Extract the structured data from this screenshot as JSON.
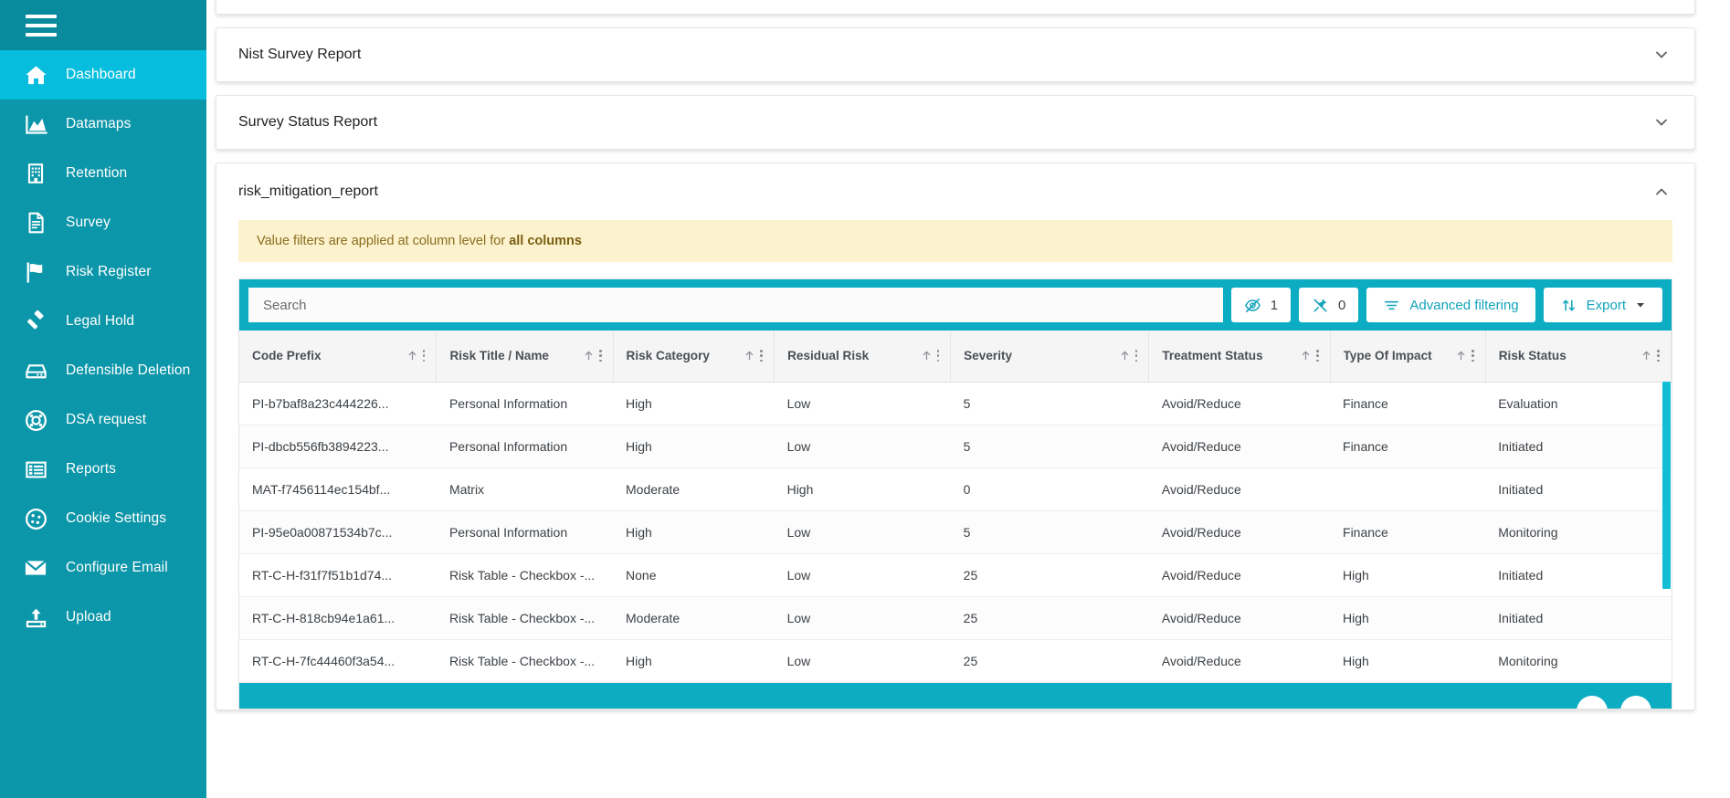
{
  "sidebar": {
    "menu_icon": "hamburger-icon",
    "items": [
      {
        "label": "Dashboard",
        "icon": "home-icon",
        "active": true
      },
      {
        "label": "Datamaps",
        "icon": "chart-area-icon",
        "active": false
      },
      {
        "label": "Retention",
        "icon": "building-icon",
        "active": false
      },
      {
        "label": "Survey",
        "icon": "document-icon",
        "active": false
      },
      {
        "label": "Risk Register",
        "icon": "flag-icon",
        "active": false
      },
      {
        "label": "Legal Hold",
        "icon": "gavel-icon",
        "active": false
      },
      {
        "label": "Defensible Deletion",
        "icon": "server-icon",
        "active": false
      },
      {
        "label": "DSA request",
        "icon": "lifebuoy-icon",
        "active": false
      },
      {
        "label": "Reports",
        "icon": "list-icon",
        "active": false
      },
      {
        "label": "Cookie Settings",
        "icon": "cookie-icon",
        "active": false
      },
      {
        "label": "Configure Email",
        "icon": "envelope-icon",
        "active": false
      },
      {
        "label": "Upload",
        "icon": "upload-icon",
        "active": false
      }
    ]
  },
  "accordions": [
    {
      "title": "Nist Survey Report",
      "expanded": false,
      "chevron": "chevron-down-icon"
    },
    {
      "title": "Survey Status Report",
      "expanded": false,
      "chevron": "chevron-down-icon"
    },
    {
      "title": "risk_mitigation_report",
      "expanded": true,
      "chevron": "chevron-up-icon"
    }
  ],
  "notice": {
    "text": "Value filters are applied at column level for ",
    "emphasis": "all columns"
  },
  "toolbar": {
    "search_placeholder": "Search",
    "search_value": "",
    "hidden_columns_count": "1",
    "hidden_columns_icon": "eye-off-icon",
    "pinned_columns_count": "0",
    "pinned_columns_icon": "pin-off-icon",
    "advanced_filtering_label": "Advanced filtering",
    "advanced_filtering_icon": "filter-icon",
    "export_label": "Export",
    "export_icon": "sort-updown-icon",
    "export_caret": "caret-down-icon"
  },
  "table": {
    "columns": [
      "Code Prefix",
      "Risk Title / Name",
      "Risk Category",
      "Residual Risk",
      "Severity",
      "Treatment Status",
      "Type Of Impact",
      "Risk Status"
    ],
    "rows": [
      [
        "PI-b7baf8a23c444226...",
        "Personal Information",
        "High",
        "Low",
        "5",
        "Avoid/Reduce",
        "Finance",
        "Evaluation"
      ],
      [
        "PI-dbcb556fb3894223...",
        "Personal Information",
        "High",
        "Low",
        "5",
        "Avoid/Reduce",
        "Finance",
        "Initiated"
      ],
      [
        "MAT-f7456114ec154bf...",
        "Matrix",
        "Moderate",
        "High",
        "0",
        "Avoid/Reduce",
        "",
        "Initiated"
      ],
      [
        "PI-95e0a00871534b7c...",
        "Personal Information",
        "High",
        "Low",
        "5",
        "Avoid/Reduce",
        "Finance",
        "Monitoring"
      ],
      [
        "RT-C-H-f31f7f51b1d74...",
        "Risk Table - Checkbox -...",
        "None",
        "Low",
        "25",
        "Avoid/Reduce",
        "High",
        "Initiated"
      ],
      [
        "RT-C-H-818cb94e1a61...",
        "Risk Table - Checkbox -...",
        "Moderate",
        "Low",
        "25",
        "Avoid/Reduce",
        "High",
        "Initiated"
      ],
      [
        "RT-C-H-7fc44460f3a54...",
        "Risk Table - Checkbox -...",
        "High",
        "Low",
        "25",
        "Avoid/Reduce",
        "High",
        "Monitoring"
      ]
    ],
    "sort_icon": "sort-asc-arrow-icon",
    "column_menu_icon": "kebab-menu-icon",
    "scrollbar": "vertical-scrollbar"
  },
  "colors": {
    "sidebar_bg": "#0c96a9",
    "sidebar_active": "#06bddd",
    "toolbar_teal": "#0cacc3",
    "notice_bg": "#fcf2cd",
    "notice_text": "#8a6d1f",
    "link_teal": "#13a3bb",
    "scrollbar_thumb": "#12bdd6"
  }
}
